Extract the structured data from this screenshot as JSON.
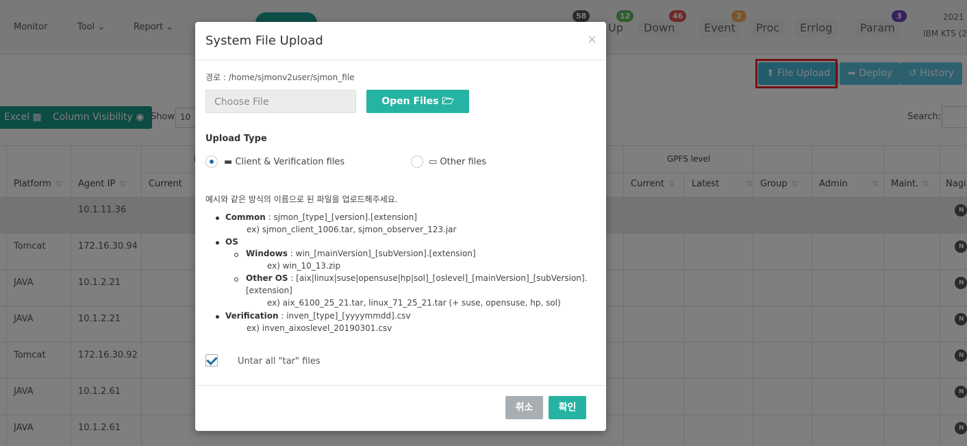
{
  "nav": {
    "monitor": "Monitor",
    "tool": "Tool ⌄",
    "report": "Report ⌄"
  },
  "status": {
    "up": {
      "label": "Up",
      "count": "12",
      "color": "#5cb85c"
    },
    "down": {
      "label": "Down",
      "count": "46",
      "color": "#d9534f"
    },
    "event": {
      "label": "Event",
      "count": "2",
      "color": "#f0ad4e"
    },
    "proc": {
      "label": "Proc"
    },
    "errlog": {
      "label": "Errlog"
    },
    "param": {
      "label": "Param",
      "count": "3",
      "color": "#6f42c1"
    },
    "other_count": "58"
  },
  "top_right": {
    "line1": "2021",
    "line2": "IBM KTS (2"
  },
  "toolbar": {
    "file_upload": "File Upload",
    "deploy": "Deploy",
    "history": "History",
    "excel": "Excel",
    "column_visibility": "Column Visibility",
    "show": "Show",
    "show_value": "10",
    "search": "Search:"
  },
  "table": {
    "group_headers": {
      "gpfs": "GPFS level",
      "partial": "I"
    },
    "headers": {
      "platform": "Platform",
      "agent_ip": "Agent IP",
      "current": "Current",
      "gpfs_current": "Current",
      "gpfs_latest": "Latest",
      "group": "Group",
      "admin": "Admin",
      "maint": "Maint.",
      "nagios": "Nagi"
    },
    "rows": [
      {
        "platform": "",
        "ip": "10.1.11.36"
      },
      {
        "platform": "Tomcat",
        "ip": "172.16.30.94"
      },
      {
        "platform": "JAVA",
        "ip": "10.1.2.21"
      },
      {
        "platform": "JAVA",
        "ip": "10.1.2.21"
      },
      {
        "platform": "Tomcat",
        "ip": "172.16.30.92"
      },
      {
        "platform": "JAVA",
        "ip": "10.1.2.61"
      },
      {
        "platform": "JAVA",
        "ip": "10.1.2.61"
      }
    ],
    "badge": "N"
  },
  "modal": {
    "title": "System File Upload",
    "close": "×",
    "path": "경로 : /home/sjmonv2user/sjmon_file",
    "choose_placeholder": "Choose File",
    "open_files": "Open Files",
    "upload_type_title": "Upload Type",
    "option_client": "Client & Verification files",
    "option_other": "Other files",
    "guide": "예시와 같은 방식의 이름으로 된 파일을 업로드해주세요.",
    "common_label": "Common",
    "common_text": " : sjmon_[type]_[version].[extension]",
    "common_ex": "ex) sjmon_client_1006.tar, sjmon_observer_123.jar",
    "os_label": "OS",
    "windows_label": "Windows",
    "windows_text": " : win_[mainVersion]_[subVersion].[extension]",
    "windows_ex": "ex) win_10_13.zip",
    "otheros_label": "Other OS",
    "otheros_text": " : [aix|linux|suse|opensuse|hp|sol]_[oslevel]_[mainVersion]_[subVersion].",
    "otheros_text2": "[extension]",
    "otheros_ex": "ex) aix_6100_25_21.tar, linux_71_25_21.tar (+ suse, opensuse, hp, sol)",
    "verification_label": "Verification",
    "verification_text": " : inven_[type]_[yyyymmdd].csv",
    "verification_ex": "ex) inven_aixoslevel_20190301.csv",
    "untar": "Untar all \"tar\" files",
    "cancel": "취소",
    "confirm": "확인"
  }
}
